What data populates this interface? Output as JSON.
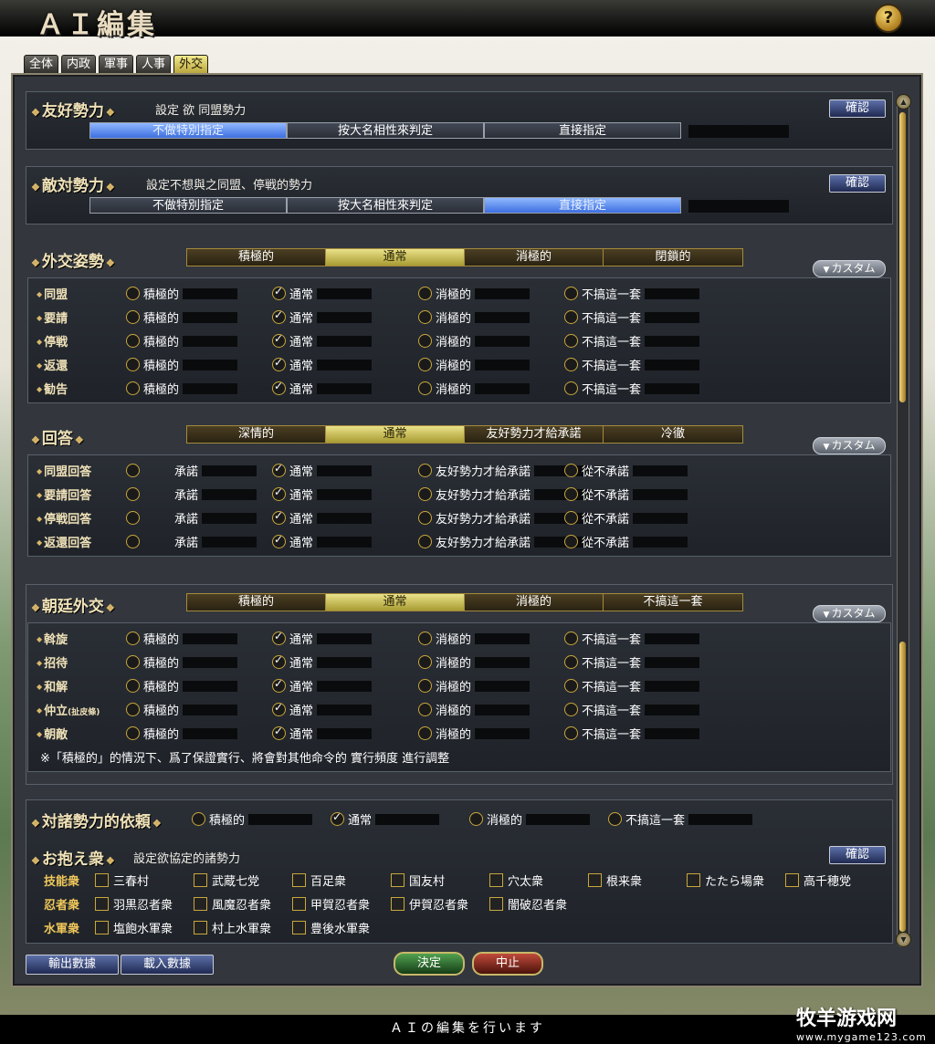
{
  "app": {
    "title": "ＡＩ編集",
    "help": "?"
  },
  "tabs": [
    "全体",
    "内政",
    "軍事",
    "人事",
    "外交"
  ],
  "active_tab": 4,
  "confirm_label": "確認",
  "custom_label": "カスタム",
  "friendly": {
    "title": "友好勢力",
    "desc": "設定 欲 同盟勢力",
    "options": [
      "不做特別指定",
      "按大名相性來判定",
      "直接指定"
    ],
    "selected": 0
  },
  "hostile": {
    "title": "敵対勢力",
    "desc": "設定不想與之同盟、停戦的勢力",
    "options": [
      "不做特別指定",
      "按大名相性來判定",
      "直接指定"
    ],
    "selected": 2
  },
  "diplomacy": {
    "title": "外交姿勢",
    "levels": [
      "積極的",
      "通常",
      "消極的",
      "閉鎖的"
    ],
    "selected": 1,
    "options": [
      "積極的",
      "通常",
      "消極的",
      "不搞這一套"
    ],
    "rows": [
      {
        "label": "同盟",
        "checked": 1
      },
      {
        "label": "要請",
        "checked": 1
      },
      {
        "label": "停戦",
        "checked": 1
      },
      {
        "label": "返還",
        "checked": 1
      },
      {
        "label": "勧告",
        "checked": 1
      }
    ]
  },
  "answer": {
    "title": "回答",
    "levels": [
      "深情的",
      "通常",
      "友好勢力才給承諾",
      "冷徹"
    ],
    "selected": 1,
    "options": [
      "承諾",
      "通常",
      "友好勢力才給承諾",
      "從不承諾"
    ],
    "rows": [
      {
        "label": "同盟回答",
        "checked": 1
      },
      {
        "label": "要請回答",
        "checked": 1
      },
      {
        "label": "停戦回答",
        "checked": 1
      },
      {
        "label": "返還回答",
        "checked": 1
      }
    ]
  },
  "court": {
    "title": "朝廷外交",
    "levels": [
      "積極的",
      "通常",
      "消極的",
      "不搞這一套"
    ],
    "selected": 1,
    "options": [
      "積極的",
      "通常",
      "消極的",
      "不搞這一套"
    ],
    "rows": [
      {
        "label": "斡旋",
        "checked": 1
      },
      {
        "label": "招待",
        "checked": 1
      },
      {
        "label": "和解",
        "checked": 1
      },
      {
        "label": "仲立",
        "sub": "(扯皮條)",
        "checked": 1
      },
      {
        "label": "朝敵",
        "checked": 1
      }
    ],
    "note": "※「積極的」的情況下、爲了保證實行、將會對其他命令的 實行頻度 進行調整"
  },
  "reliance": {
    "title": "対諸勢力的依頼",
    "options": [
      "積極的",
      "通常",
      "消極的",
      "不搞這一套"
    ],
    "checked": 1
  },
  "retainers": {
    "title": "お抱え衆",
    "desc": "設定欲協定的諸勢力",
    "groups": [
      {
        "label": "技能衆",
        "items": [
          "三春村",
          "武蔵七党",
          "百足衆",
          "国友村",
          "穴太衆",
          "根来衆",
          "たたら場衆",
          "高千穂党"
        ]
      },
      {
        "label": "忍者衆",
        "items": [
          "羽黒忍者衆",
          "風魔忍者衆",
          "甲賀忍者衆",
          "伊賀忍者衆",
          "闇破忍者衆"
        ]
      },
      {
        "label": "水軍衆",
        "items": [
          "塩飽水軍衆",
          "村上水軍衆",
          "豊後水軍衆"
        ]
      }
    ]
  },
  "footer": {
    "export": "輸出數據",
    "import": "載入數據",
    "ok": "決定",
    "cancel": "中止",
    "status": "ＡＩの編集を行います"
  },
  "watermark": {
    "text": "牧羊游戏网",
    "url": "www.mygame123.com"
  }
}
